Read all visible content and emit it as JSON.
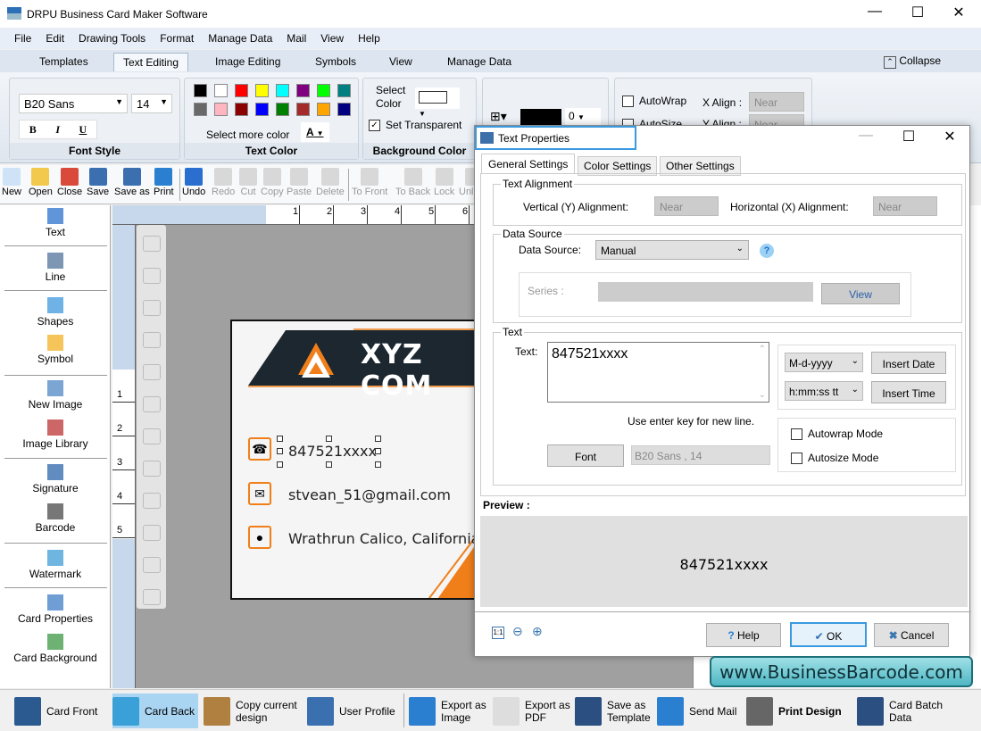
{
  "app": {
    "title": "DRPU Business Card Maker Software"
  },
  "menu": [
    "File",
    "Edit",
    "Drawing Tools",
    "Format",
    "Manage Data",
    "Mail",
    "View",
    "Help"
  ],
  "ribbon_tabs": [
    {
      "label": "Templates"
    },
    {
      "label": "Text Editing",
      "active": true
    },
    {
      "label": "Image Editing"
    },
    {
      "label": "Symbols"
    },
    {
      "label": "View"
    },
    {
      "label": "Manage Data"
    }
  ],
  "collapse_label": "Collapse",
  "font_style": {
    "font": "B20 Sans",
    "size": "14",
    "bold": "B",
    "italic": "I",
    "underline": "U",
    "label": "Font Style"
  },
  "text_color": {
    "swatches": [
      "#000000",
      "#ffffff",
      "#ff0000",
      "#ffff00",
      "#00ffff",
      "#800080",
      "#00ff00",
      "#008080",
      "#696969",
      "#ffb6c1",
      "#8b0000",
      "#0000ff",
      "#008000",
      "#a52a2a",
      "#ffa500",
      "#000080"
    ],
    "more": "Select more color",
    "a": "A",
    "label": "Text Color"
  },
  "background_color": {
    "select_color": "Select Color",
    "set_transparent": "Set Transparent",
    "transparent_checked": true,
    "label": "Background Color"
  },
  "border": {
    "width": "0"
  },
  "align_group": {
    "autowrap": "AutoWrap",
    "autosize": "AutoSize",
    "x_align": "X Align :",
    "y_align": "Y Align :",
    "x_value": "Near",
    "y_value": "Near"
  },
  "toolbar": [
    "New",
    "Open",
    "Close",
    "Save",
    "Save as",
    "Print",
    "Undo",
    "Redo",
    "Cut",
    "Copy",
    "Paste",
    "Delete",
    "To Front",
    "To Back",
    "Lock",
    "Unlock"
  ],
  "toolbar_disabled": [
    "Redo",
    "Cut",
    "Copy",
    "Paste",
    "Delete",
    "To Front",
    "To Back",
    "Lock",
    "Unlock"
  ],
  "left_panel": [
    "Text",
    "Line",
    "Shapes",
    "Symbol",
    "New Image",
    "Image Library",
    "Signature",
    "Barcode",
    "Watermark",
    "Card Properties",
    "Card Background"
  ],
  "ruler_h": [
    "1",
    "2",
    "3",
    "4",
    "5",
    "6"
  ],
  "ruler_v": [
    "1",
    "2",
    "3",
    "4",
    "5"
  ],
  "card": {
    "company": "XYZ COM",
    "phone": "847521xxxx",
    "email": "stvean_51@gmail.com",
    "address": "Wrathrun Calico, California",
    "accent": "#f07f1a",
    "dark": "#1c2730"
  },
  "dialog": {
    "title": "Text Properties",
    "tabs": [
      "General Settings",
      "Color Settings",
      "Other Settings"
    ],
    "text_alignment": {
      "legend": "Text Alignment",
      "vertical_label": "Vertical (Y) Alignment:",
      "vertical_value": "Near",
      "horizontal_label": "Horizontal (X) Alignment:",
      "horizontal_value": "Near"
    },
    "data_source": {
      "legend": "Data Source",
      "label": "Data Source:",
      "value": "Manual",
      "series_label": "Series :",
      "view": "View"
    },
    "text": {
      "legend": "Text",
      "label": "Text:",
      "value": "847521xxxx",
      "date_format": "M-d-yyyy",
      "time_format": "h:mm:ss tt",
      "insert_date": "Insert Date",
      "insert_time": "Insert Time",
      "hint": "Use enter key for new line.",
      "font_button": "Font",
      "font_value": "B20 Sans , 14",
      "autowrap": "Autowrap Mode",
      "autosize": "Autosize Mode"
    },
    "preview_label": "Preview :",
    "preview_text": "847521xxxx",
    "zoom_11": "1:1",
    "help": "Help",
    "ok": "OK",
    "cancel": "Cancel"
  },
  "watermark_url": "www.BusinessBarcode.com",
  "bottom_bar": [
    "Card Front",
    "Card Back",
    "Copy current design",
    "User Profile",
    "Export as Image",
    "Export as PDF",
    "Save as Template",
    "Send Mail",
    "Print Design",
    "Card Batch Data"
  ]
}
